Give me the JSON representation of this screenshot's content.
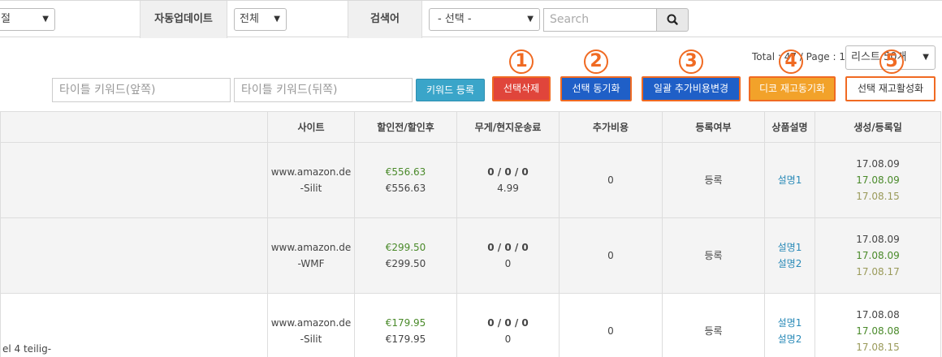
{
  "filters": {
    "first_select": {
      "value": "절"
    },
    "auto_update": {
      "label": "자동업데이트",
      "value": "전체"
    },
    "search": {
      "label": "검색어",
      "select_value": "- 선택 -",
      "placeholder": "Search"
    }
  },
  "toolbar": {
    "total_text": "Total : 47 / Page : 1",
    "list_size": "리스트 50개",
    "kw_front_placeholder": "타이틀 키워드(앞쪽)",
    "kw_back_placeholder": "타이틀 키워드(뒤쪽)",
    "kw_register": "키워드 등록",
    "delete_selected": "선택삭제",
    "sync_selected": "선택 동기화",
    "bulk_extra_cost": "일괄 추가비용변경",
    "stock_sync": "디코 재고동기화",
    "stock_activate": "선택 재고활성화",
    "markers": [
      "1",
      "2",
      "3",
      "4",
      "5"
    ]
  },
  "table": {
    "headers": [
      "사이트",
      "할인전/할인후",
      "무게/현지운송료",
      "추가비용",
      "등록여부",
      "상품설명",
      "생성/등록일"
    ],
    "rows": [
      {
        "title": "",
        "site": "www.amazon.de",
        "brand": "-Silit",
        "price_before": "€556.63",
        "price_after": "€556.63",
        "weight": "0 / 0 / 0",
        "shipping": "4.99",
        "extra": "0",
        "status": "등록",
        "desc": [
          "설명1"
        ],
        "created": "17.08.09",
        "registered": "17.08.09",
        "updated": "17.08.15"
      },
      {
        "title": "",
        "site": "www.amazon.de",
        "brand": "-WMF",
        "price_before": "€299.50",
        "price_after": "€299.50",
        "weight": "0 / 0 / 0",
        "shipping": "0",
        "extra": "0",
        "status": "등록",
        "desc": [
          "설명1",
          "설명2"
        ],
        "created": "17.08.09",
        "registered": "17.08.09",
        "updated": "17.08.17"
      },
      {
        "title": "el 4 teilig-",
        "site": "www.amazon.de",
        "brand": "-Silit",
        "price_before": "€179.95",
        "price_after": "€179.95",
        "weight": "0 / 0 / 0",
        "shipping": "0",
        "extra": "0",
        "status": "등록",
        "desc": [
          "설명1",
          "설명2"
        ],
        "created": "17.08.08",
        "registered": "17.08.08",
        "updated": "17.08.15"
      }
    ]
  },
  "colors": {
    "accent_orange": "#f06a22",
    "primary_blue": "#1f5fc7",
    "danger_red": "#e0453b",
    "warning": "#f2a22a",
    "teal": "#3aa5c9"
  }
}
